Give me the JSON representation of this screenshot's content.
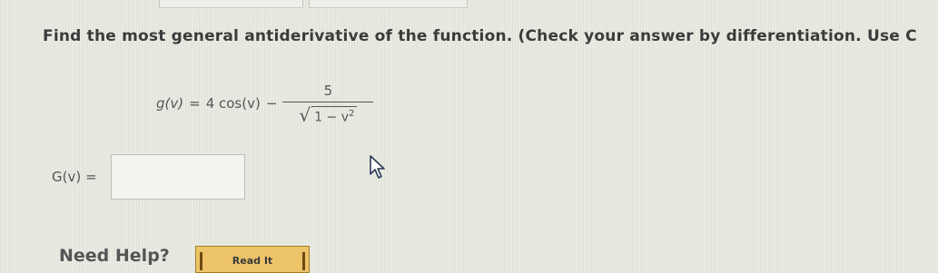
{
  "question": {
    "text": "Find the most general antiderivative of the function. (Check your answer by differentiation. Use C"
  },
  "formula": {
    "lhs": "g(v)",
    "equals": "=",
    "term1": "4 cos(v)",
    "minus": "−",
    "numerator": "5",
    "sqrt_symbol": "√",
    "radicand_base": "1 − v",
    "radicand_exp": "2"
  },
  "answer": {
    "label": "G(v) =",
    "value": ""
  },
  "help": {
    "need_help_label": "Need Help?",
    "read_it_label": "Read It"
  },
  "icons": {
    "cursor": "mouse-pointer-icon"
  }
}
